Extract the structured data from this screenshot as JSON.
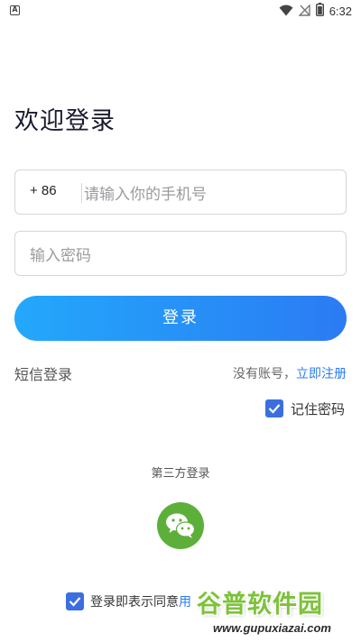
{
  "status_bar": {
    "time": "6:32",
    "icons": [
      "a-icon",
      "wifi-icon",
      "no-signal-icon",
      "battery-icon"
    ]
  },
  "header": {
    "title": "欢迎登录"
  },
  "form": {
    "country_code": "+ 86",
    "phone_placeholder": "请输入你的手机号",
    "password_placeholder": "输入密码",
    "login_button": "登录"
  },
  "links": {
    "sms_login": "短信登录",
    "no_account": "没有账号，",
    "register": "立即注册"
  },
  "remember": {
    "label": "记住密码",
    "checked": true
  },
  "third_party": {
    "label": "第三方登录",
    "providers": [
      "wechat-icon"
    ]
  },
  "agreement": {
    "text": "登录即表示同意",
    "link": "用",
    "checked": true
  },
  "watermark": {
    "main": "谷普软件园",
    "sub": "www.gupuxiazai.com"
  },
  "colors": {
    "accent": "#2b7bf3",
    "button_gradient_start": "#23a8fb",
    "button_gradient_end": "#2b7bf3",
    "checkbox": "#3b6fe0",
    "wechat": "#5cb03a"
  }
}
